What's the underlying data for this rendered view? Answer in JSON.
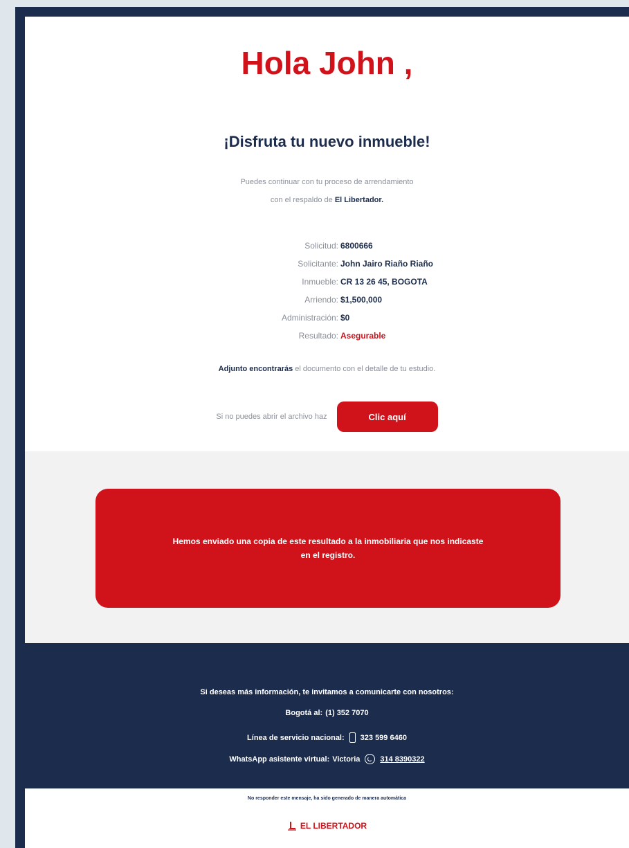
{
  "greeting": "Hola John ,",
  "subtitle": "¡Disfruta tu nuevo inmueble!",
  "intro": {
    "line1": "Puedes continuar con tu proceso de arrendamiento",
    "line2_prefix": "con el respaldo de ",
    "line2_brand": "El Libertador."
  },
  "details": [
    {
      "label": "Solicitud:",
      "value": "6800666"
    },
    {
      "label": "Solicitante:",
      "value": "John Jairo Riaño Riaño"
    },
    {
      "label": "Inmueble:",
      "value": "CR 13 26 45, BOGOTA"
    },
    {
      "label": "Arriendo:",
      "value": "$1,500,000"
    },
    {
      "label": "Administración:",
      "value": "$0"
    },
    {
      "label": "Resultado:",
      "value": "Asegurable"
    }
  ],
  "attached": {
    "bold": "Adjunto encontrarás",
    "rest": " el documento con el detalle de tu estudio."
  },
  "open_file": {
    "text": "Si no puedes abrir el archivo haz",
    "button": "Clic aquí"
  },
  "notice": {
    "line1": "Hemos enviado una copia de este resultado a la inmobiliaria que nos indicaste",
    "line2": "en el registro."
  },
  "footer": {
    "info": "Si deseas más información, te invitamos a comunicarte con nosotros:",
    "bogota_label": "Bogotá al:",
    "bogota_phone": "(1) 352 7070",
    "national_label": "Línea de servicio nacional:",
    "national_phone": "323 599 6460",
    "whatsapp_label": "WhatsApp asistente virtual:",
    "whatsapp_name": "Victoria",
    "whatsapp_phone": "314 8390322"
  },
  "disclaimer": "No responder este mensaje, ha sido generado de manera automática",
  "brand": "EL LIBERTADOR",
  "colors": {
    "red": "#d0121b",
    "navy": "#1c2c4c",
    "gray_text": "#8a8f99"
  }
}
